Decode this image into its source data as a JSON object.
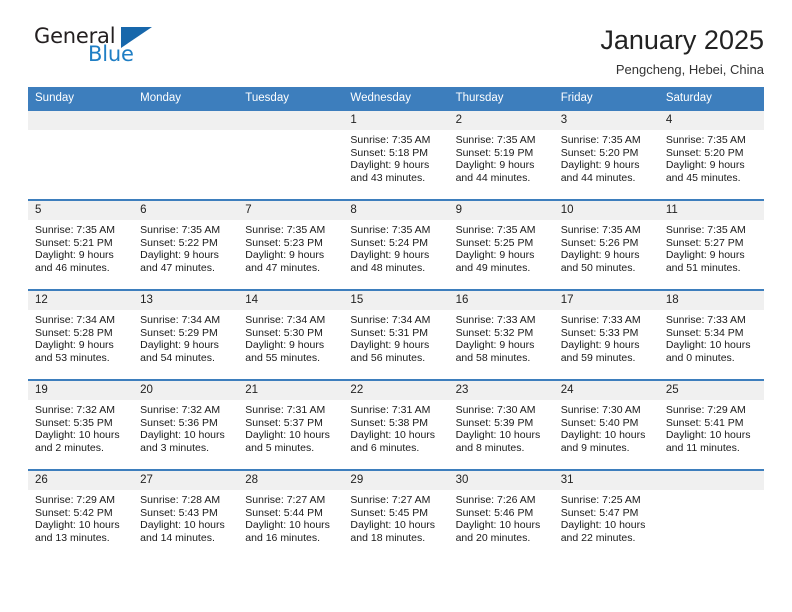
{
  "logo": {
    "text_top": "General",
    "text_bottom": "Blue",
    "triangle_icon": "triangle-icon",
    "color_dark": "#231f20",
    "color_blue": "#1f7ec4",
    "color_triangle": "#1767ab"
  },
  "header": {
    "title": "January 2025",
    "subtitle": "Pengcheng, Hebei, China"
  },
  "theme": {
    "header_row_bg": "#3d7ebd",
    "header_row_text": "#ffffff",
    "daynum_bg": "#f0f0f0",
    "cell_bg": "#ffffff",
    "row_border": "#3d7ebd"
  },
  "weekdays": [
    "Sunday",
    "Monday",
    "Tuesday",
    "Wednesday",
    "Thursday",
    "Friday",
    "Saturday"
  ],
  "weeks": [
    [
      {
        "day": "",
        "sunrise": "",
        "sunset": "",
        "daylight": "",
        "empty": true
      },
      {
        "day": "",
        "sunrise": "",
        "sunset": "",
        "daylight": "",
        "empty": true
      },
      {
        "day": "",
        "sunrise": "",
        "sunset": "",
        "daylight": "",
        "empty": true
      },
      {
        "day": "1",
        "sunrise": "Sunrise: 7:35 AM",
        "sunset": "Sunset: 5:18 PM",
        "daylight": "Daylight: 9 hours and 43 minutes.",
        "empty": false
      },
      {
        "day": "2",
        "sunrise": "Sunrise: 7:35 AM",
        "sunset": "Sunset: 5:19 PM",
        "daylight": "Daylight: 9 hours and 44 minutes.",
        "empty": false
      },
      {
        "day": "3",
        "sunrise": "Sunrise: 7:35 AM",
        "sunset": "Sunset: 5:20 PM",
        "daylight": "Daylight: 9 hours and 44 minutes.",
        "empty": false
      },
      {
        "day": "4",
        "sunrise": "Sunrise: 7:35 AM",
        "sunset": "Sunset: 5:20 PM",
        "daylight": "Daylight: 9 hours and 45 minutes.",
        "empty": false
      }
    ],
    [
      {
        "day": "5",
        "sunrise": "Sunrise: 7:35 AM",
        "sunset": "Sunset: 5:21 PM",
        "daylight": "Daylight: 9 hours and 46 minutes.",
        "empty": false
      },
      {
        "day": "6",
        "sunrise": "Sunrise: 7:35 AM",
        "sunset": "Sunset: 5:22 PM",
        "daylight": "Daylight: 9 hours and 47 minutes.",
        "empty": false
      },
      {
        "day": "7",
        "sunrise": "Sunrise: 7:35 AM",
        "sunset": "Sunset: 5:23 PM",
        "daylight": "Daylight: 9 hours and 47 minutes.",
        "empty": false
      },
      {
        "day": "8",
        "sunrise": "Sunrise: 7:35 AM",
        "sunset": "Sunset: 5:24 PM",
        "daylight": "Daylight: 9 hours and 48 minutes.",
        "empty": false
      },
      {
        "day": "9",
        "sunrise": "Sunrise: 7:35 AM",
        "sunset": "Sunset: 5:25 PM",
        "daylight": "Daylight: 9 hours and 49 minutes.",
        "empty": false
      },
      {
        "day": "10",
        "sunrise": "Sunrise: 7:35 AM",
        "sunset": "Sunset: 5:26 PM",
        "daylight": "Daylight: 9 hours and 50 minutes.",
        "empty": false
      },
      {
        "day": "11",
        "sunrise": "Sunrise: 7:35 AM",
        "sunset": "Sunset: 5:27 PM",
        "daylight": "Daylight: 9 hours and 51 minutes.",
        "empty": false
      }
    ],
    [
      {
        "day": "12",
        "sunrise": "Sunrise: 7:34 AM",
        "sunset": "Sunset: 5:28 PM",
        "daylight": "Daylight: 9 hours and 53 minutes.",
        "empty": false
      },
      {
        "day": "13",
        "sunrise": "Sunrise: 7:34 AM",
        "sunset": "Sunset: 5:29 PM",
        "daylight": "Daylight: 9 hours and 54 minutes.",
        "empty": false
      },
      {
        "day": "14",
        "sunrise": "Sunrise: 7:34 AM",
        "sunset": "Sunset: 5:30 PM",
        "daylight": "Daylight: 9 hours and 55 minutes.",
        "empty": false
      },
      {
        "day": "15",
        "sunrise": "Sunrise: 7:34 AM",
        "sunset": "Sunset: 5:31 PM",
        "daylight": "Daylight: 9 hours and 56 minutes.",
        "empty": false
      },
      {
        "day": "16",
        "sunrise": "Sunrise: 7:33 AM",
        "sunset": "Sunset: 5:32 PM",
        "daylight": "Daylight: 9 hours and 58 minutes.",
        "empty": false
      },
      {
        "day": "17",
        "sunrise": "Sunrise: 7:33 AM",
        "sunset": "Sunset: 5:33 PM",
        "daylight": "Daylight: 9 hours and 59 minutes.",
        "empty": false
      },
      {
        "day": "18",
        "sunrise": "Sunrise: 7:33 AM",
        "sunset": "Sunset: 5:34 PM",
        "daylight": "Daylight: 10 hours and 0 minutes.",
        "empty": false
      }
    ],
    [
      {
        "day": "19",
        "sunrise": "Sunrise: 7:32 AM",
        "sunset": "Sunset: 5:35 PM",
        "daylight": "Daylight: 10 hours and 2 minutes.",
        "empty": false
      },
      {
        "day": "20",
        "sunrise": "Sunrise: 7:32 AM",
        "sunset": "Sunset: 5:36 PM",
        "daylight": "Daylight: 10 hours and 3 minutes.",
        "empty": false
      },
      {
        "day": "21",
        "sunrise": "Sunrise: 7:31 AM",
        "sunset": "Sunset: 5:37 PM",
        "daylight": "Daylight: 10 hours and 5 minutes.",
        "empty": false
      },
      {
        "day": "22",
        "sunrise": "Sunrise: 7:31 AM",
        "sunset": "Sunset: 5:38 PM",
        "daylight": "Daylight: 10 hours and 6 minutes.",
        "empty": false
      },
      {
        "day": "23",
        "sunrise": "Sunrise: 7:30 AM",
        "sunset": "Sunset: 5:39 PM",
        "daylight": "Daylight: 10 hours and 8 minutes.",
        "empty": false
      },
      {
        "day": "24",
        "sunrise": "Sunrise: 7:30 AM",
        "sunset": "Sunset: 5:40 PM",
        "daylight": "Daylight: 10 hours and 9 minutes.",
        "empty": false
      },
      {
        "day": "25",
        "sunrise": "Sunrise: 7:29 AM",
        "sunset": "Sunset: 5:41 PM",
        "daylight": "Daylight: 10 hours and 11 minutes.",
        "empty": false
      }
    ],
    [
      {
        "day": "26",
        "sunrise": "Sunrise: 7:29 AM",
        "sunset": "Sunset: 5:42 PM",
        "daylight": "Daylight: 10 hours and 13 minutes.",
        "empty": false
      },
      {
        "day": "27",
        "sunrise": "Sunrise: 7:28 AM",
        "sunset": "Sunset: 5:43 PM",
        "daylight": "Daylight: 10 hours and 14 minutes.",
        "empty": false
      },
      {
        "day": "28",
        "sunrise": "Sunrise: 7:27 AM",
        "sunset": "Sunset: 5:44 PM",
        "daylight": "Daylight: 10 hours and 16 minutes.",
        "empty": false
      },
      {
        "day": "29",
        "sunrise": "Sunrise: 7:27 AM",
        "sunset": "Sunset: 5:45 PM",
        "daylight": "Daylight: 10 hours and 18 minutes.",
        "empty": false
      },
      {
        "day": "30",
        "sunrise": "Sunrise: 7:26 AM",
        "sunset": "Sunset: 5:46 PM",
        "daylight": "Daylight: 10 hours and 20 minutes.",
        "empty": false
      },
      {
        "day": "31",
        "sunrise": "Sunrise: 7:25 AM",
        "sunset": "Sunset: 5:47 PM",
        "daylight": "Daylight: 10 hours and 22 minutes.",
        "empty": false
      },
      {
        "day": "",
        "sunrise": "",
        "sunset": "",
        "daylight": "",
        "empty": true
      }
    ]
  ]
}
